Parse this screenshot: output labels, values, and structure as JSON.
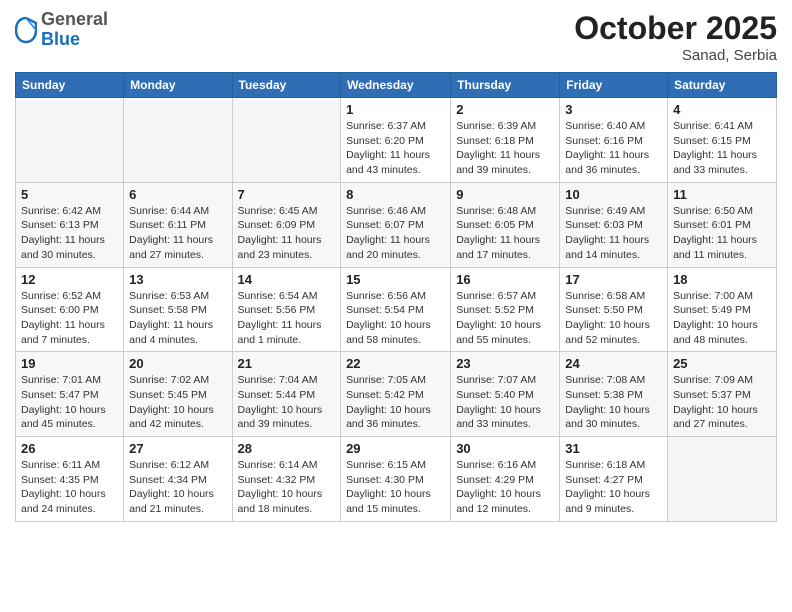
{
  "header": {
    "logo": {
      "general": "General",
      "blue": "Blue"
    },
    "month": "October 2025",
    "location": "Sanad, Serbia"
  },
  "days_of_week": [
    "Sunday",
    "Monday",
    "Tuesday",
    "Wednesday",
    "Thursday",
    "Friday",
    "Saturday"
  ],
  "weeks": [
    [
      {
        "day": "",
        "info": ""
      },
      {
        "day": "",
        "info": ""
      },
      {
        "day": "",
        "info": ""
      },
      {
        "day": "1",
        "info": "Sunrise: 6:37 AM\nSunset: 6:20 PM\nDaylight: 11 hours\nand 43 minutes."
      },
      {
        "day": "2",
        "info": "Sunrise: 6:39 AM\nSunset: 6:18 PM\nDaylight: 11 hours\nand 39 minutes."
      },
      {
        "day": "3",
        "info": "Sunrise: 6:40 AM\nSunset: 6:16 PM\nDaylight: 11 hours\nand 36 minutes."
      },
      {
        "day": "4",
        "info": "Sunrise: 6:41 AM\nSunset: 6:15 PM\nDaylight: 11 hours\nand 33 minutes."
      }
    ],
    [
      {
        "day": "5",
        "info": "Sunrise: 6:42 AM\nSunset: 6:13 PM\nDaylight: 11 hours\nand 30 minutes."
      },
      {
        "day": "6",
        "info": "Sunrise: 6:44 AM\nSunset: 6:11 PM\nDaylight: 11 hours\nand 27 minutes."
      },
      {
        "day": "7",
        "info": "Sunrise: 6:45 AM\nSunset: 6:09 PM\nDaylight: 11 hours\nand 23 minutes."
      },
      {
        "day": "8",
        "info": "Sunrise: 6:46 AM\nSunset: 6:07 PM\nDaylight: 11 hours\nand 20 minutes."
      },
      {
        "day": "9",
        "info": "Sunrise: 6:48 AM\nSunset: 6:05 PM\nDaylight: 11 hours\nand 17 minutes."
      },
      {
        "day": "10",
        "info": "Sunrise: 6:49 AM\nSunset: 6:03 PM\nDaylight: 11 hours\nand 14 minutes."
      },
      {
        "day": "11",
        "info": "Sunrise: 6:50 AM\nSunset: 6:01 PM\nDaylight: 11 hours\nand 11 minutes."
      }
    ],
    [
      {
        "day": "12",
        "info": "Sunrise: 6:52 AM\nSunset: 6:00 PM\nDaylight: 11 hours\nand 7 minutes."
      },
      {
        "day": "13",
        "info": "Sunrise: 6:53 AM\nSunset: 5:58 PM\nDaylight: 11 hours\nand 4 minutes."
      },
      {
        "day": "14",
        "info": "Sunrise: 6:54 AM\nSunset: 5:56 PM\nDaylight: 11 hours\nand 1 minute."
      },
      {
        "day": "15",
        "info": "Sunrise: 6:56 AM\nSunset: 5:54 PM\nDaylight: 10 hours\nand 58 minutes."
      },
      {
        "day": "16",
        "info": "Sunrise: 6:57 AM\nSunset: 5:52 PM\nDaylight: 10 hours\nand 55 minutes."
      },
      {
        "day": "17",
        "info": "Sunrise: 6:58 AM\nSunset: 5:50 PM\nDaylight: 10 hours\nand 52 minutes."
      },
      {
        "day": "18",
        "info": "Sunrise: 7:00 AM\nSunset: 5:49 PM\nDaylight: 10 hours\nand 48 minutes."
      }
    ],
    [
      {
        "day": "19",
        "info": "Sunrise: 7:01 AM\nSunset: 5:47 PM\nDaylight: 10 hours\nand 45 minutes."
      },
      {
        "day": "20",
        "info": "Sunrise: 7:02 AM\nSunset: 5:45 PM\nDaylight: 10 hours\nand 42 minutes."
      },
      {
        "day": "21",
        "info": "Sunrise: 7:04 AM\nSunset: 5:44 PM\nDaylight: 10 hours\nand 39 minutes."
      },
      {
        "day": "22",
        "info": "Sunrise: 7:05 AM\nSunset: 5:42 PM\nDaylight: 10 hours\nand 36 minutes."
      },
      {
        "day": "23",
        "info": "Sunrise: 7:07 AM\nSunset: 5:40 PM\nDaylight: 10 hours\nand 33 minutes."
      },
      {
        "day": "24",
        "info": "Sunrise: 7:08 AM\nSunset: 5:38 PM\nDaylight: 10 hours\nand 30 minutes."
      },
      {
        "day": "25",
        "info": "Sunrise: 7:09 AM\nSunset: 5:37 PM\nDaylight: 10 hours\nand 27 minutes."
      }
    ],
    [
      {
        "day": "26",
        "info": "Sunrise: 6:11 AM\nSunset: 4:35 PM\nDaylight: 10 hours\nand 24 minutes."
      },
      {
        "day": "27",
        "info": "Sunrise: 6:12 AM\nSunset: 4:34 PM\nDaylight: 10 hours\nand 21 minutes."
      },
      {
        "day": "28",
        "info": "Sunrise: 6:14 AM\nSunset: 4:32 PM\nDaylight: 10 hours\nand 18 minutes."
      },
      {
        "day": "29",
        "info": "Sunrise: 6:15 AM\nSunset: 4:30 PM\nDaylight: 10 hours\nand 15 minutes."
      },
      {
        "day": "30",
        "info": "Sunrise: 6:16 AM\nSunset: 4:29 PM\nDaylight: 10 hours\nand 12 minutes."
      },
      {
        "day": "31",
        "info": "Sunrise: 6:18 AM\nSunset: 4:27 PM\nDaylight: 10 hours\nand 9 minutes."
      },
      {
        "day": "",
        "info": ""
      }
    ]
  ]
}
